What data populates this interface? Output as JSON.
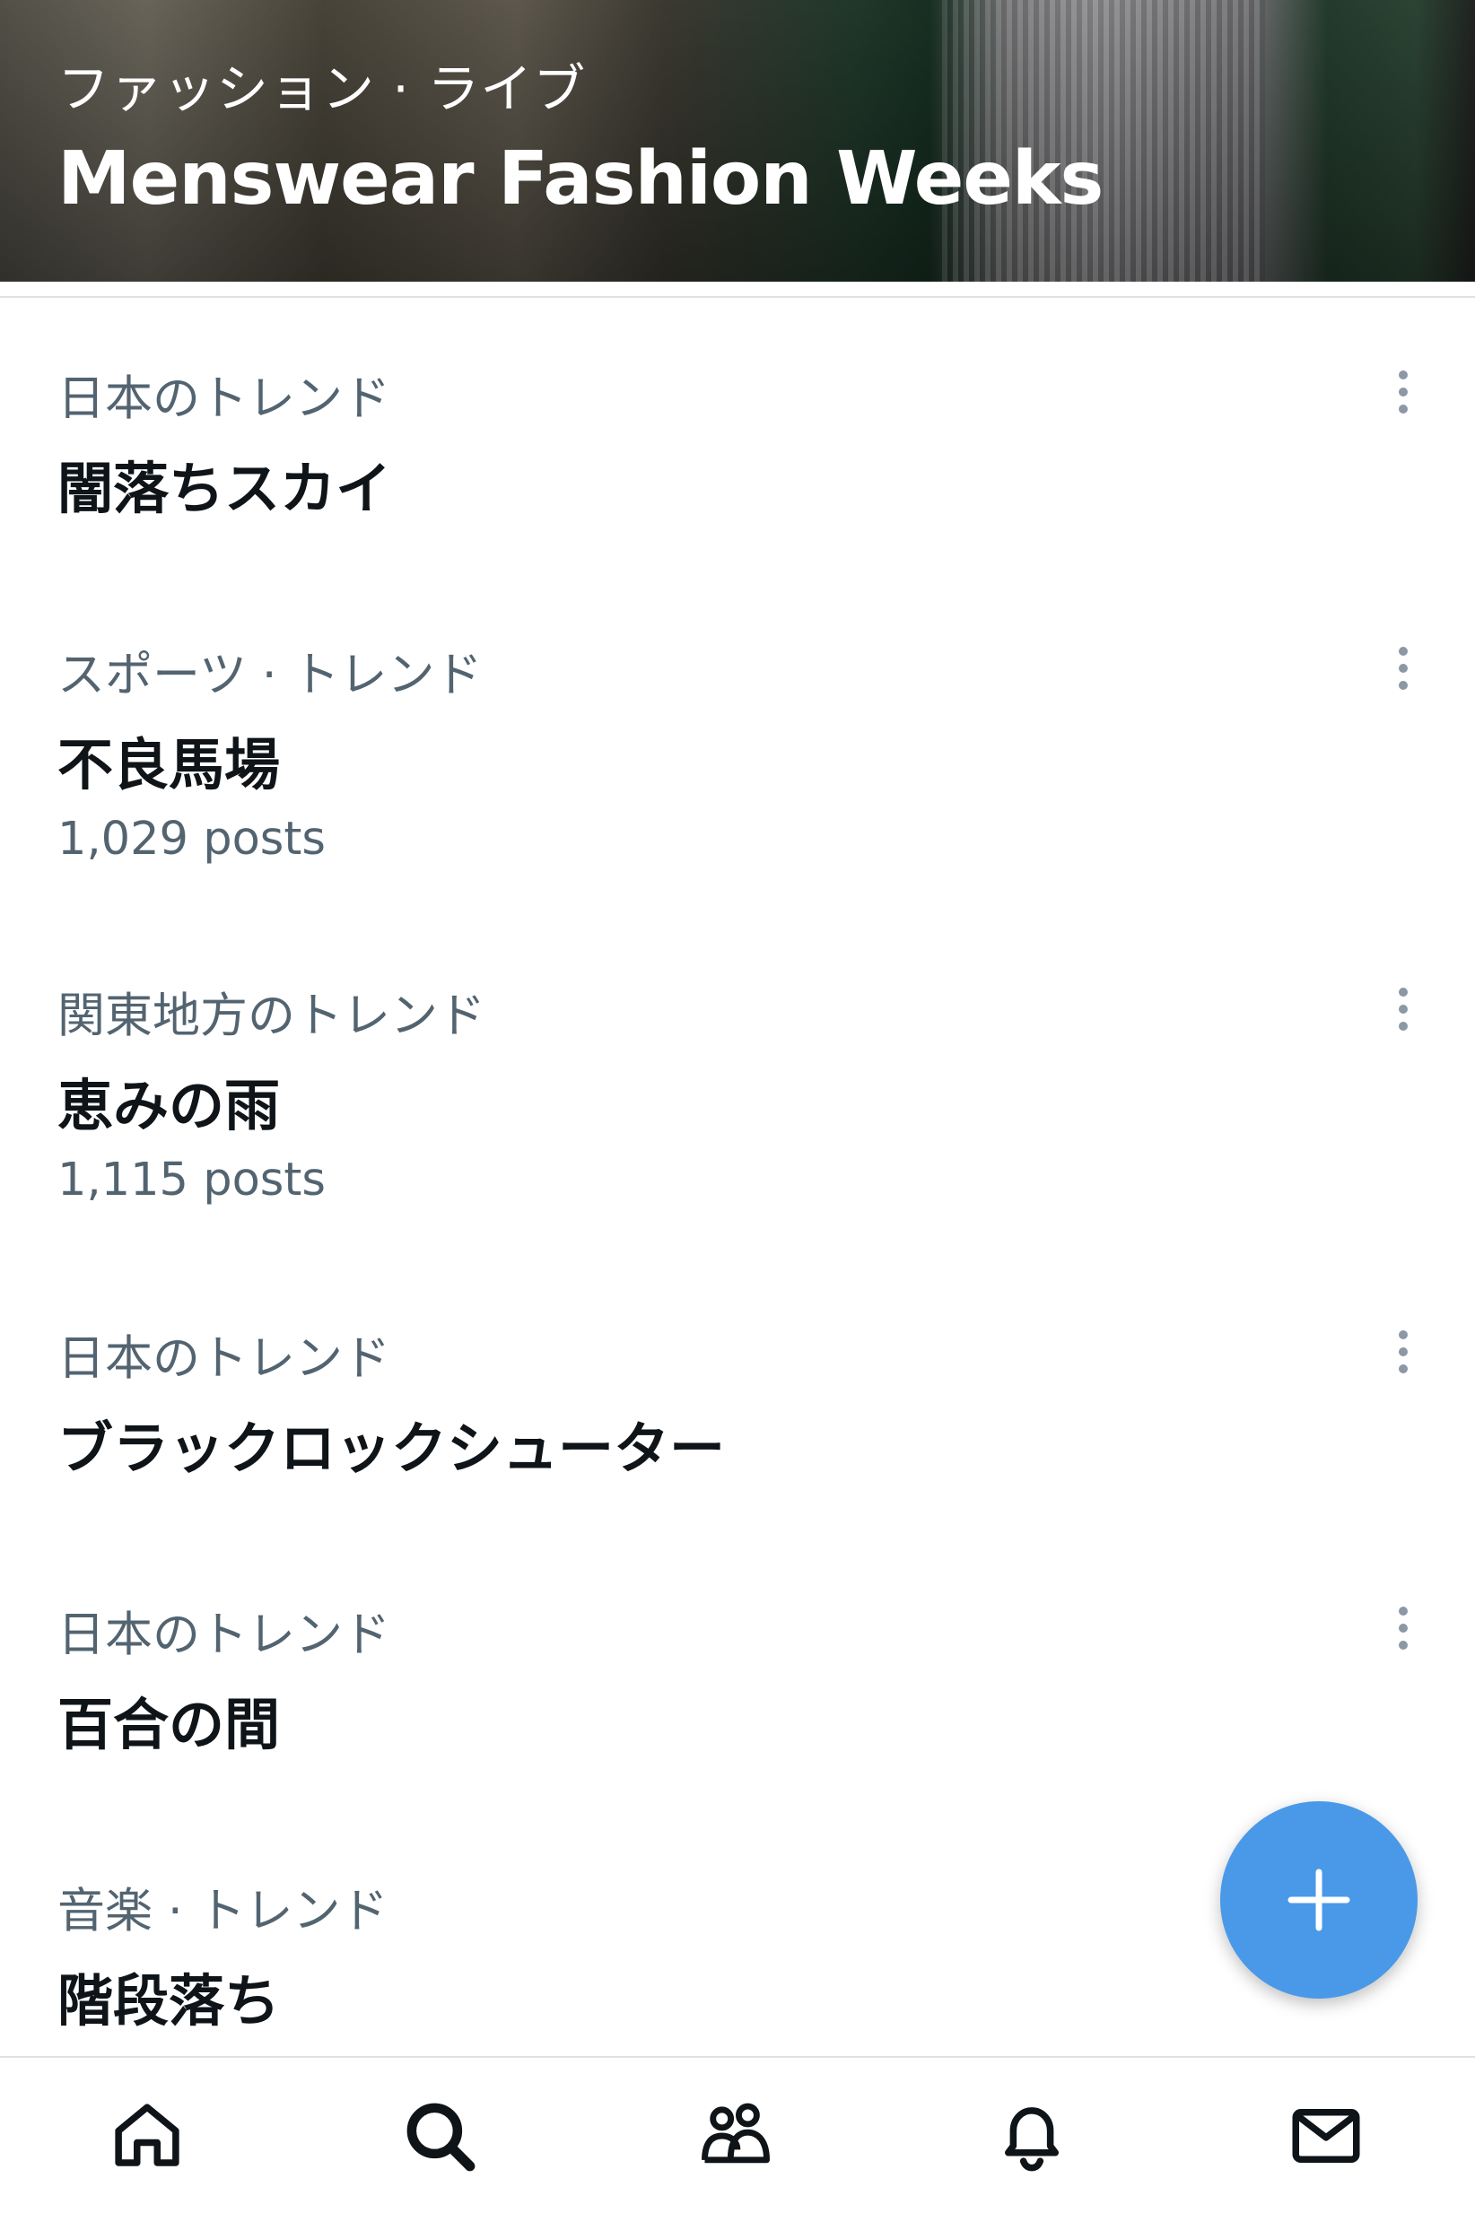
{
  "hero": {
    "category": "ファッション · ライブ",
    "title": "Menswear Fashion Weeks"
  },
  "trends": [
    {
      "category": "日本のトレンド",
      "name": "闇落ちスカイ",
      "count": ""
    },
    {
      "category": "スポーツ · トレンド",
      "name": "不良馬場",
      "count": "1,029 posts"
    },
    {
      "category": "関東地方のトレンド",
      "name": "恵みの雨",
      "count": "1,115 posts"
    },
    {
      "category": "日本のトレンド",
      "name": "ブラックロックシューター",
      "count": ""
    },
    {
      "category": "日本のトレンド",
      "name": "百合の間",
      "count": ""
    },
    {
      "category": "音楽 · トレンド",
      "name": "階段落ち",
      "count": ""
    }
  ],
  "fab": {
    "icon": "plus-icon",
    "color": "#4a99e9"
  },
  "bottom_nav": [
    {
      "icon": "home-icon"
    },
    {
      "icon": "search-icon"
    },
    {
      "icon": "communities-icon"
    },
    {
      "icon": "bell-icon"
    },
    {
      "icon": "mail-icon"
    }
  ],
  "colors": {
    "primary_text": "#0f1419",
    "secondary_text": "#536471",
    "accent": "#4a99e9",
    "divider": "#dde2e6"
  }
}
